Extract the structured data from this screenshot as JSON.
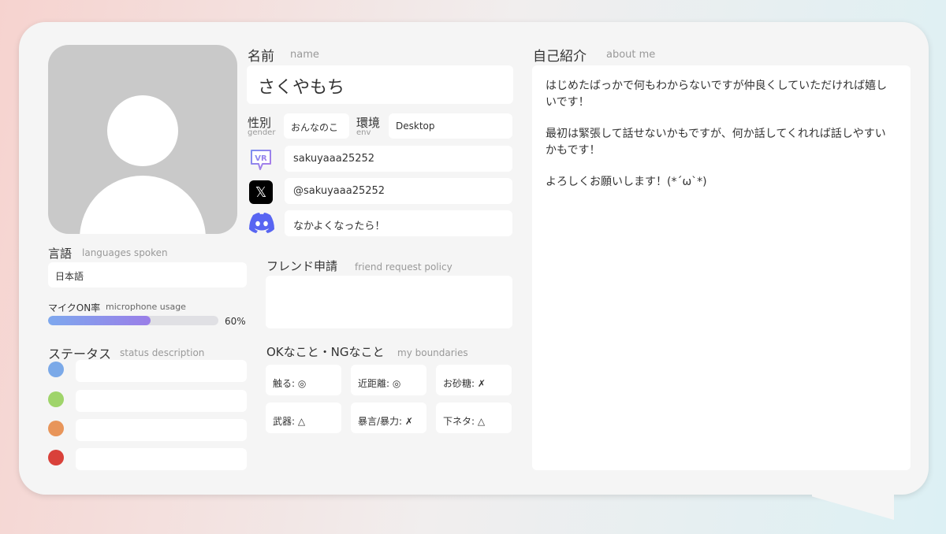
{
  "left": {
    "languages_label_ja": "言語",
    "languages_label_en": "languages spoken",
    "languages_value": "日本語",
    "mic_label_ja": "マイクON率",
    "mic_label_en": "microphone usage",
    "mic_percent_text": "60%",
    "mic_fraction": 0.6,
    "status_label_ja": "ステータス",
    "status_label_en": "status description",
    "status_colors": [
      "#7ba9e8",
      "#9fd46a",
      "#e8955a",
      "#d9413a"
    ]
  },
  "profile": {
    "name_label_ja": "名前",
    "name_label_en": "name",
    "name_value": "さくやもち",
    "gender_label_ja": "性別",
    "gender_label_en": "gender",
    "gender_value": "おんなのこ",
    "env_label_ja": "環境",
    "env_label_en": "env",
    "env_value": "Desktop",
    "vrchat_value": "sakuyaaa25252",
    "x_value": "@sakuyaaa25252",
    "discord_value": "なかよくなったら！"
  },
  "friend": {
    "label_ja": "フレンド申請",
    "label_en": "friend request policy"
  },
  "boundaries": {
    "label_ja": "OKなこと・NGなこと",
    "label_en": "my boundaries",
    "items": [
      "触る: ◎",
      "近距離: ◎",
      "お砂糖: ✗",
      "武器: △",
      "暴言/暴力: ✗",
      "下ネタ: △"
    ]
  },
  "about": {
    "label_ja": "自己紹介",
    "label_en": "about me",
    "p1": "はじめたばっかで何もわからないですが仲良くしていただければ嬉しいです！",
    "p2": "最初は緊張して話せないかもですが、何か話してくれれば話しやすいかもです！",
    "p3": "よろしくお願いします！(*´ω`*)"
  },
  "icons": [
    "vrchat-icon",
    "x-icon",
    "discord-icon"
  ]
}
